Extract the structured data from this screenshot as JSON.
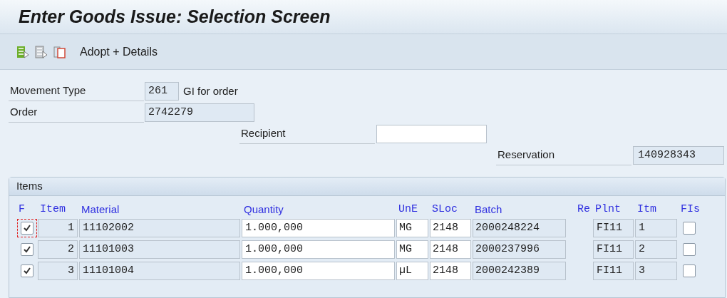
{
  "window": {
    "title": "Enter Goods Issue: Selection Screen"
  },
  "toolbar": {
    "button_label": "Adopt + Details"
  },
  "form": {
    "movement_type": {
      "label": "Movement Type",
      "value": "261",
      "description": "GI for order"
    },
    "order": {
      "label": "Order",
      "value": "2742279"
    },
    "recipient": {
      "label": "Recipient"
    },
    "reservation": {
      "label": "Reservation",
      "value": "140928343"
    }
  },
  "items": {
    "title": "Items",
    "columns": [
      "F",
      "Item",
      "Material",
      "Quantity",
      "UnE",
      "SLoc",
      "Batch",
      "Re",
      "Plnt",
      "Itm",
      "FIs"
    ],
    "rows": [
      {
        "checked": true,
        "focused": true,
        "item": "1",
        "material": "11102002",
        "quantity": "1.000,000",
        "unit": "MG",
        "sloc": "2148",
        "batch": "2000248224",
        "plant": "FI11",
        "itm": "1",
        "fis_checked": false
      },
      {
        "checked": true,
        "focused": false,
        "item": "2",
        "material": "11101003",
        "quantity": "1.000,000",
        "unit": "MG",
        "sloc": "2148",
        "batch": "2000237996",
        "plant": "FI11",
        "itm": "2",
        "fis_checked": false
      },
      {
        "checked": true,
        "focused": false,
        "item": "3",
        "material": "11101004",
        "quantity": "1.000,000",
        "unit": "µL",
        "sloc": "2148",
        "batch": "2000242389",
        "plant": "FI11",
        "itm": "3",
        "fis_checked": false
      }
    ]
  }
}
